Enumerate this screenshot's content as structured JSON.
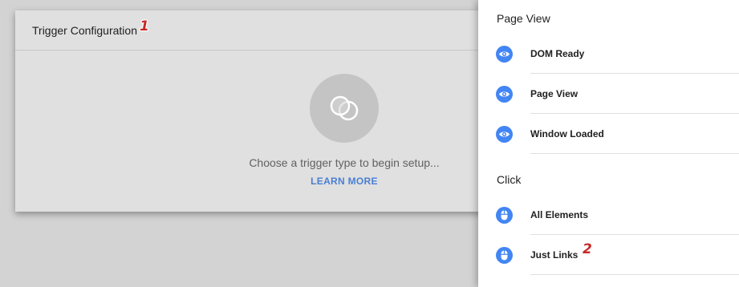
{
  "trigger_config": {
    "title": "Trigger Configuration",
    "annotation": "1",
    "empty_message": "Choose a trigger type to begin setup...",
    "learn_more": "LEARN MORE"
  },
  "trigger_types": {
    "annotation": "2",
    "sections": [
      {
        "label": "Page View",
        "items": [
          {
            "label": "DOM Ready",
            "icon": "eye-icon"
          },
          {
            "label": "Page View",
            "icon": "eye-icon"
          },
          {
            "label": "Window Loaded",
            "icon": "eye-icon"
          }
        ]
      },
      {
        "label": "Click",
        "items": [
          {
            "label": "All Elements",
            "icon": "mouse-icon"
          },
          {
            "label": "Just Links",
            "icon": "mouse-icon"
          }
        ]
      }
    ]
  },
  "colors": {
    "accent": "#4285f4",
    "link": "#4a7fd4",
    "annotation": "#c62828"
  }
}
